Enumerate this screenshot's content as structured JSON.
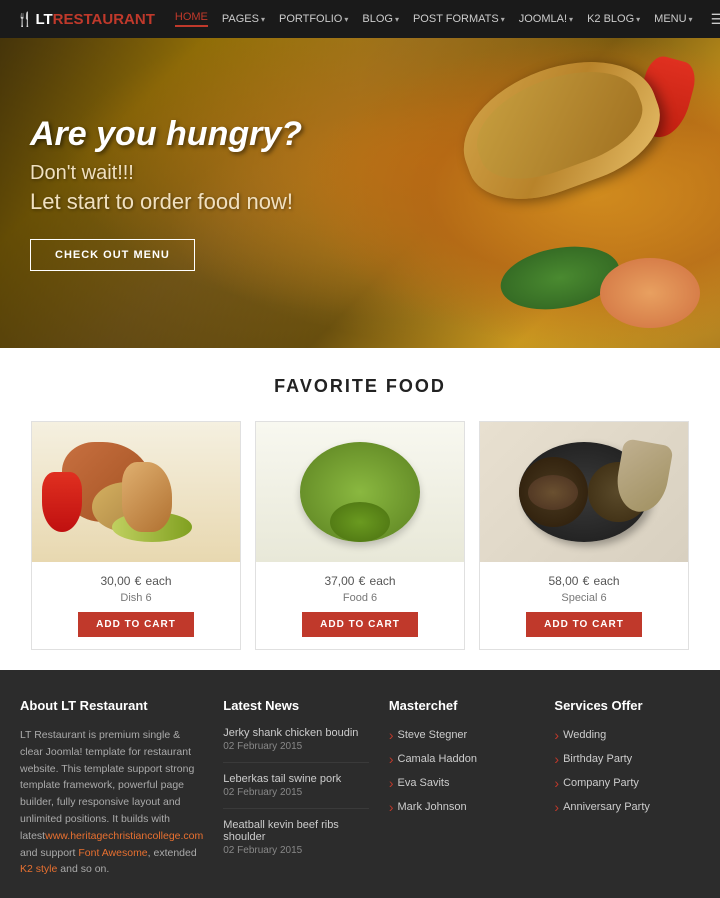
{
  "header": {
    "logo": {
      "fork": "🍴",
      "lt": "LT",
      "restaurant": "RESTAURANT"
    },
    "nav": [
      {
        "label": "HOME",
        "active": true,
        "hasArrow": false
      },
      {
        "label": "PAGES",
        "active": false,
        "hasArrow": true
      },
      {
        "label": "PORTFOLIO",
        "active": false,
        "hasArrow": true
      },
      {
        "label": "BLOG",
        "active": false,
        "hasArrow": true
      },
      {
        "label": "POST FORMATS",
        "active": false,
        "hasArrow": true
      },
      {
        "label": "JOOMLA!",
        "active": false,
        "hasArrow": true
      },
      {
        "label": "K2 BLOG",
        "active": false,
        "hasArrow": true
      },
      {
        "label": "MENU",
        "active": false,
        "hasArrow": true
      }
    ]
  },
  "hero": {
    "title": "Are you hungry?",
    "subtitle1": "Don't wait!!!",
    "subtitle2": "Let start to order food now!",
    "button_label": "CHECK OUT MENU"
  },
  "food_section": {
    "title": "FAVORITE FOOD",
    "items": [
      {
        "price": "30,00",
        "currency": "€",
        "unit": "each",
        "name": "Dish 6",
        "button": "ADD TO CART"
      },
      {
        "price": "37,00",
        "currency": "€",
        "unit": "each",
        "name": "Food 6",
        "button": "ADD TO CART"
      },
      {
        "price": "58,00",
        "currency": "€",
        "unit": "each",
        "name": "Special 6",
        "button": "ADD TO CART"
      }
    ]
  },
  "footer": {
    "about": {
      "title": "About LT Restaurant",
      "text_before_link1": "LT Restaurant is premium single & clear Joomla! template for restaurant website. This template support strong template framework, powerful page builder, fully responsive layout and unlimited positions. It builds with latest",
      "link1": "www.heritagechristiancollege.com",
      "text_between": " and support ",
      "link2": "Font Awesome",
      "text_after": ", extended ",
      "link3": "K2 style",
      "text_end": " and so on."
    },
    "news": {
      "title": "Latest News",
      "items": [
        {
          "title": "Jerky shank chicken boudin",
          "date": "02 February 2015"
        },
        {
          "title": "Leberkas tail swine pork",
          "date": "02 February 2015"
        },
        {
          "title": "Meatball kevin beef ribs shoulder",
          "date": "02 February 2015"
        }
      ]
    },
    "masterchef": {
      "title": "Masterchef",
      "items": [
        "Steve Stegner",
        "Camala Haddon",
        "Eva Savits",
        "Mark Johnson"
      ]
    },
    "services": {
      "title": "Services Offer",
      "items": [
        "Wedding",
        "Birthday Party",
        "Company Party",
        "Anniversary Party"
      ]
    }
  }
}
